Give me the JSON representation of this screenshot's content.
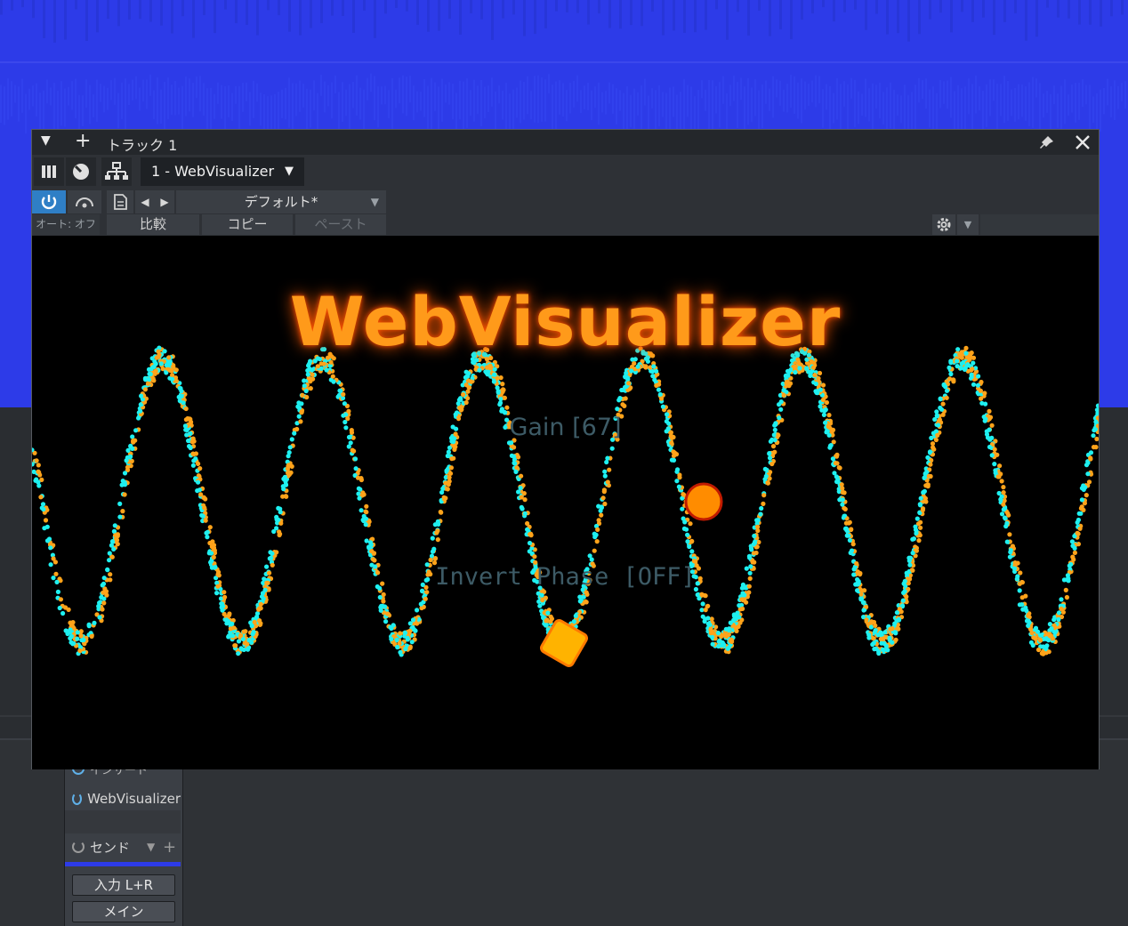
{
  "plugin_window": {
    "title": "トラック 1",
    "preset_instance": "1 - WebVisualizer",
    "preset_name": "デフォルト*",
    "auto_label": "オート: オフ",
    "compare_label": "比較",
    "copy_label": "コピー",
    "paste_label": "ペースト"
  },
  "visualizer": {
    "title": "WebVisualizer",
    "gain_label": "Gain [67]",
    "gain_value": 67,
    "invert_phase_label": "Invert Phase [OFF]",
    "colors": {
      "title": "#ff9a1a",
      "wave_a": "#ffa31a",
      "wave_b": "#1ef0f0",
      "slider": "#ffc000",
      "knob": "#ff8c00"
    }
  },
  "mixer": {
    "insert_label": "インサート",
    "plugin_label": "WebVisualizer",
    "send_label": "センド",
    "input_label": "入力 L+R",
    "main_label": "メイン"
  }
}
